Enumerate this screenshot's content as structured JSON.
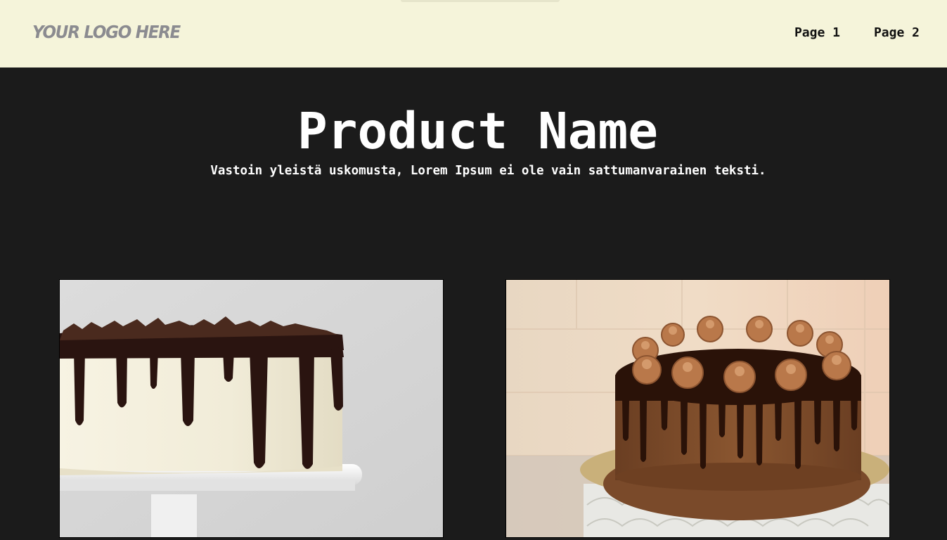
{
  "header": {
    "logo_text": "YOUR LOGO HERE",
    "nav": [
      {
        "label": "Page 1"
      },
      {
        "label": "Page 2"
      }
    ]
  },
  "hero": {
    "title": "Product Name",
    "subtitle": "Vastoin yleistä uskomusta, Lorem Ipsum ei ole vain sattumanvarainen teksti."
  },
  "colors": {
    "header_bg": "#f5f4da",
    "page_bg": "#1b1b1b",
    "logo": "#8b8b90"
  }
}
